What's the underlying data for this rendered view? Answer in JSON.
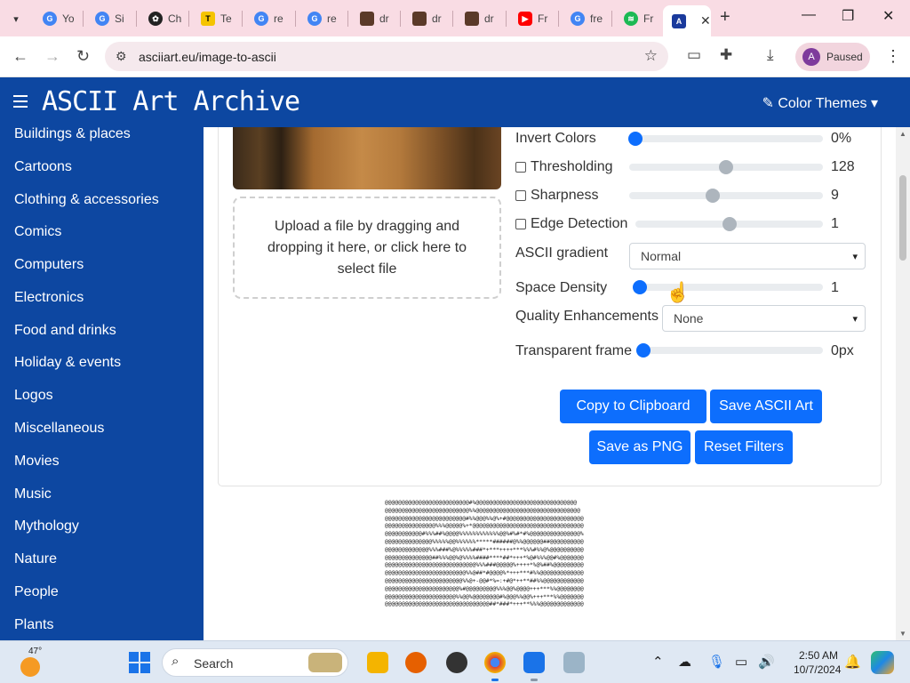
{
  "browser": {
    "tabs": [
      {
        "label": "Yo",
        "favicon": "google-icon",
        "color": "#4285f4"
      },
      {
        "label": "Si",
        "favicon": "google-icon",
        "color": "#4285f4"
      },
      {
        "label": "Ch",
        "favicon": "chatgpt-icon",
        "color": "#222222"
      },
      {
        "label": "Te",
        "favicon": "text-icon",
        "color": "#f5c400"
      },
      {
        "label": "re",
        "favicon": "google-icon",
        "color": "#4285f4"
      },
      {
        "label": "re",
        "favicon": "google-icon",
        "color": "#4285f4"
      },
      {
        "label": "dr",
        "favicon": "image-icon",
        "color": "#5b3a29"
      },
      {
        "label": "dr",
        "favicon": "image-icon",
        "color": "#5b3a29"
      },
      {
        "label": "dr",
        "favicon": "image-icon",
        "color": "#5b3a29"
      },
      {
        "label": "Fr",
        "favicon": "youtube-icon",
        "color": "#ff0000"
      },
      {
        "label": "fre",
        "favicon": "google-icon",
        "color": "#4285f4"
      },
      {
        "label": "Fr",
        "favicon": "spotify-icon",
        "color": "#1db954"
      }
    ],
    "active_tab_close": "✕",
    "new_tab": "+",
    "url": "asciiart.eu/image-to-ascii",
    "profile_initial": "A",
    "profile_status": "Paused"
  },
  "site": {
    "title": "ASCII Art Archive",
    "color_themes": "Color Themes ▾",
    "accent": "#0d47a1"
  },
  "sidebar": {
    "items": [
      "Buildings & places",
      "Cartoons",
      "Clothing & accessories",
      "Comics",
      "Computers",
      "Electronics",
      "Food and drinks",
      "Holiday & events",
      "Logos",
      "Miscellaneous",
      "Movies",
      "Music",
      "Mythology",
      "Nature",
      "People",
      "Plants"
    ]
  },
  "upload": {
    "text": "Upload a file by dragging and dropping it here, or click here to select file"
  },
  "controls": {
    "invert": {
      "label": "Invert Colors",
      "value": "0%",
      "level": 0.0
    },
    "threshold": {
      "label": "Thresholding",
      "value": "128",
      "level": 0.5,
      "checked": false
    },
    "sharpness": {
      "label": "Sharpness",
      "value": "9",
      "level": 0.43,
      "checked": false
    },
    "edge": {
      "label": "Edge Detection",
      "value": "1",
      "level": 0.5,
      "checked": false
    },
    "gradient": {
      "label": "ASCII gradient",
      "selected": "Normal"
    },
    "density": {
      "label": "Space Density",
      "value": "1",
      "level": 0.0
    },
    "quality": {
      "label": "Quality Enhancements",
      "selected": "None"
    },
    "frame": {
      "label": "Transparent frame",
      "value": "0px",
      "level": 0.0
    }
  },
  "buttons": {
    "copy": "Copy to Clipboard",
    "save_ascii": "Save ASCII Art",
    "save_png": "Save as PNG",
    "reset": "Reset Filters"
  },
  "ascii_output": "@@@@@@@@@@@@@@@@@@@@@@@@@#%@@@@@@@@@@@@@@@@@@@@@@@@@@@@@@\n@@@@@@@@@@@@@@@@@@@@@@@@@%%@@@@@@@@@@@@@@@@@@@@@@@@@@@@@@@\n@@@@@@@@@@@@@@@@@@@@@@@@#%%@@@%%@%+#@@@@@@@@@@@@@@@@@@@@@@@\n@@@@@@@@@@@@@@@%%%@@@@@%+*@@@@@@@@@@@@@@@@@@@@@@@@@@@@@@@@@\n@@@@@@@@@@@#%%%##%@@@@%%%%%%%%%%%%@@%#%#*#%@@@@@@@@@@@@@@@%\n@@@@@@@@@@@@@@%%%%%@@%%%%%%*****######@%%@@@@@@##@@@@@@@@@@\n@@@@@@@@@@@@@%%%###%@%%%%%###*+***++++***%%%#%%@%@@@@@@@@@@\n@@@@@@@@@@@@@@##%%%@@%@%%%%####****##*+++*%@#%%%@@#%@@@@@@@\n@@@@@@@@@@@@@@@@@@@@@@@@@@@%%%###@@@@@%++++*%@%##%@@@@@@@@@\n@@@@@@@@@@@@@@@@@@@@@@@@%%@##*#@@@@%*+++***#%%@@@@@@@@@@@@@\n@@@@@@@@@@@@@@@@@@@@@@@%%@+-@@#*%=:+#@*++**##%%@@@@@@@@@@@@\n@@@@@@@@@@@@@@@@@@@@@@%#@@@@@@@@@%%%@@%@@@@+++***%%@@@@@@@@\n@@@@@@@@@@@@@@@@@@@@@%%@@%@@@@@@@@#%@@@%%@@%+++***%%@@@@@@@\n@@@@@@@@@@@@@@@@@@@@@@@@@@@@@@@##*###*+++**%%%@@@@@@@@@@@@@",
  "taskbar": {
    "temperature": "47°",
    "search": "Search",
    "time": "2:50 AM",
    "date": "10/7/2024"
  }
}
